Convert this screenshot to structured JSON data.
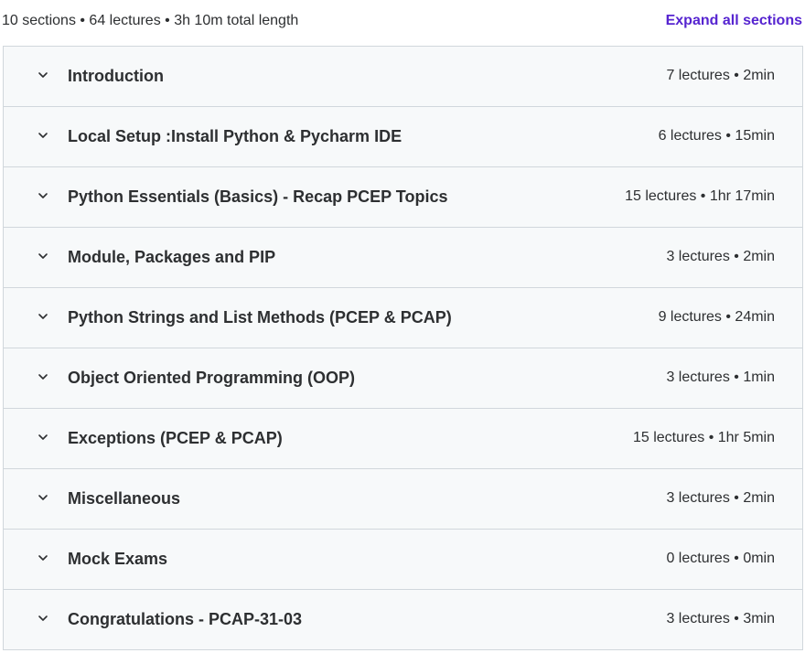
{
  "summary": {
    "text": "10 sections • 64 lectures • 3h 10m total length",
    "expand_label": "Expand all sections"
  },
  "colors": {
    "accent": "#5624d0",
    "row_bg": "#f7f9fa",
    "border": "#d1d7dc",
    "text": "#2d2f31"
  },
  "sections": [
    {
      "title": "Introduction",
      "meta": "7 lectures • 2min",
      "icon": "chevron-down-icon"
    },
    {
      "title": "Local Setup :Install Python & Pycharm IDE",
      "meta": "6 lectures • 15min",
      "icon": "chevron-down-icon"
    },
    {
      "title": "Python Essentials (Basics) - Recap PCEP Topics",
      "meta": "15 lectures • 1hr 17min",
      "icon": "chevron-down-icon"
    },
    {
      "title": "Module, Packages and PIP",
      "meta": "3 lectures • 2min",
      "icon": "chevron-down-icon"
    },
    {
      "title": "Python Strings and List Methods (PCEP & PCAP)",
      "meta": "9 lectures • 24min",
      "icon": "chevron-down-icon"
    },
    {
      "title": "Object Oriented Programming (OOP)",
      "meta": "3 lectures • 1min",
      "icon": "chevron-down-icon"
    },
    {
      "title": "Exceptions (PCEP & PCAP)",
      "meta": "15 lectures • 1hr 5min",
      "icon": "chevron-down-icon"
    },
    {
      "title": "Miscellaneous",
      "meta": "3 lectures • 2min",
      "icon": "chevron-down-icon"
    },
    {
      "title": "Mock Exams",
      "meta": "0 lectures • 0min",
      "icon": "chevron-down-icon"
    },
    {
      "title": "Congratulations - PCAP-31-03",
      "meta": "3 lectures • 3min",
      "icon": "chevron-down-icon"
    }
  ]
}
